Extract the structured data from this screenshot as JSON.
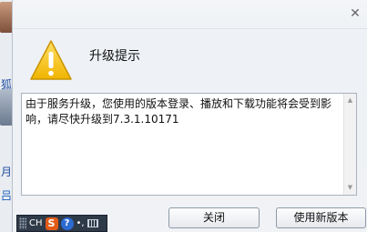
{
  "background": {
    "glyph_1": "狐",
    "glyph_2": "月",
    "glyph_3": "吕"
  },
  "dialog": {
    "title": "升级提示",
    "close_icon": "close-icon",
    "warning_icon": "warning-icon",
    "message": "由于服务升级，您使用的版本登录、播放和下载功能将会受到影响，请尽快升级到7.3.1.10171",
    "buttons": {
      "close_label": "关闭",
      "update_label": "使用新版本"
    }
  },
  "ime_toolbar": {
    "mode_label": "CH",
    "logo_letter": "S",
    "help_label": "?",
    "punct_label": "•,",
    "keyboard_icon": "keyboard-icon"
  },
  "colors": {
    "warning_yellow": "#f6c21c",
    "ime_bar": "#2f3a48",
    "ime_logo": "#e25b16",
    "help_blue": "#2d6bd3"
  }
}
